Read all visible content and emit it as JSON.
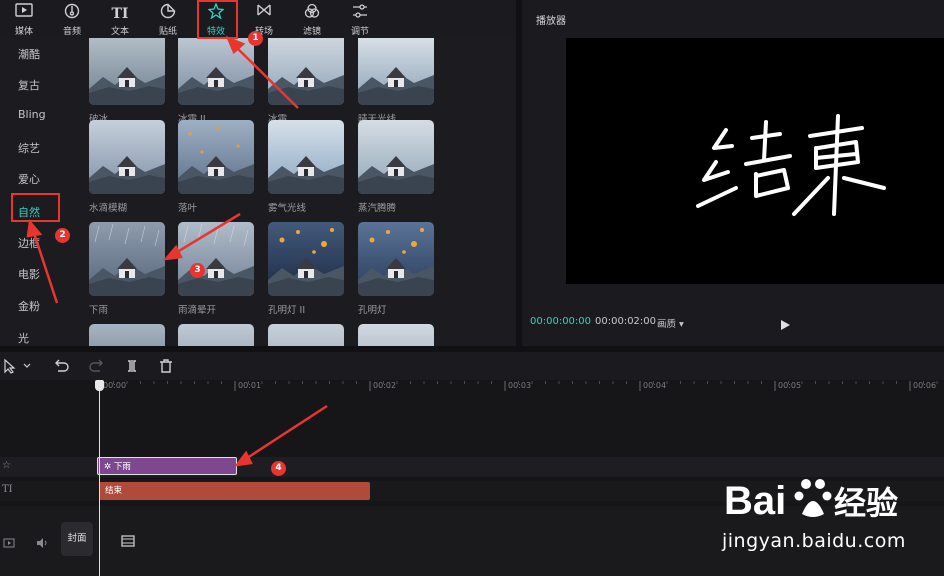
{
  "toolbar": {
    "tabs": [
      {
        "label": "媒体",
        "icon": "media-icon"
      },
      {
        "label": "音频",
        "icon": "audio-icon"
      },
      {
        "label": "文本",
        "icon": "text-icon"
      },
      {
        "label": "贴纸",
        "icon": "sticker-icon"
      },
      {
        "label": "特效",
        "icon": "effects-icon",
        "active": true
      },
      {
        "label": "转场",
        "icon": "transition-icon"
      },
      {
        "label": "滤镜",
        "icon": "filter-icon"
      },
      {
        "label": "调节",
        "icon": "adjust-icon"
      }
    ]
  },
  "categories": [
    "潮酷",
    "复古",
    "Bling",
    "综艺",
    "爱心",
    "自然",
    "边框",
    "电影",
    "金粉",
    "光"
  ],
  "active_category": "自然",
  "effects": [
    {
      "name": "破冰"
    },
    {
      "name": "冰霜 II"
    },
    {
      "name": "冰霜"
    },
    {
      "name": "晴天光线"
    },
    {
      "name": "水滴模糊"
    },
    {
      "name": "落叶"
    },
    {
      "name": "雾气光线"
    },
    {
      "name": "蒸汽腾腾"
    },
    {
      "name": "下雨"
    },
    {
      "name": "雨滴晕开"
    },
    {
      "name": "孔明灯 II"
    },
    {
      "name": "孔明灯"
    },
    {
      "name": ""
    },
    {
      "name": ""
    },
    {
      "name": ""
    },
    {
      "name": ""
    }
  ],
  "player": {
    "title": "播放器",
    "current_time": "00:00:00:00",
    "total_time": "00:00:02:00",
    "quality": "画质 ▾",
    "preview_text": "结束"
  },
  "timeline": {
    "ruler_labels": [
      "00:00",
      "00:01",
      "00:02",
      "00:03",
      "00:04",
      "00:05",
      "00:06"
    ],
    "effect_clip": "下雨",
    "text_clip": "结束",
    "cover_label": "封面"
  },
  "annotations": [
    "1",
    "2",
    "3",
    "4"
  ],
  "watermark": {
    "logo_text": "Baidu经验",
    "url": "jingyan.baidu.com"
  },
  "colors": {
    "accent": "#2ed3c5",
    "annotation": "#e8362f",
    "effect_clip": "#7d4890",
    "text_clip": "#b04a3b"
  }
}
